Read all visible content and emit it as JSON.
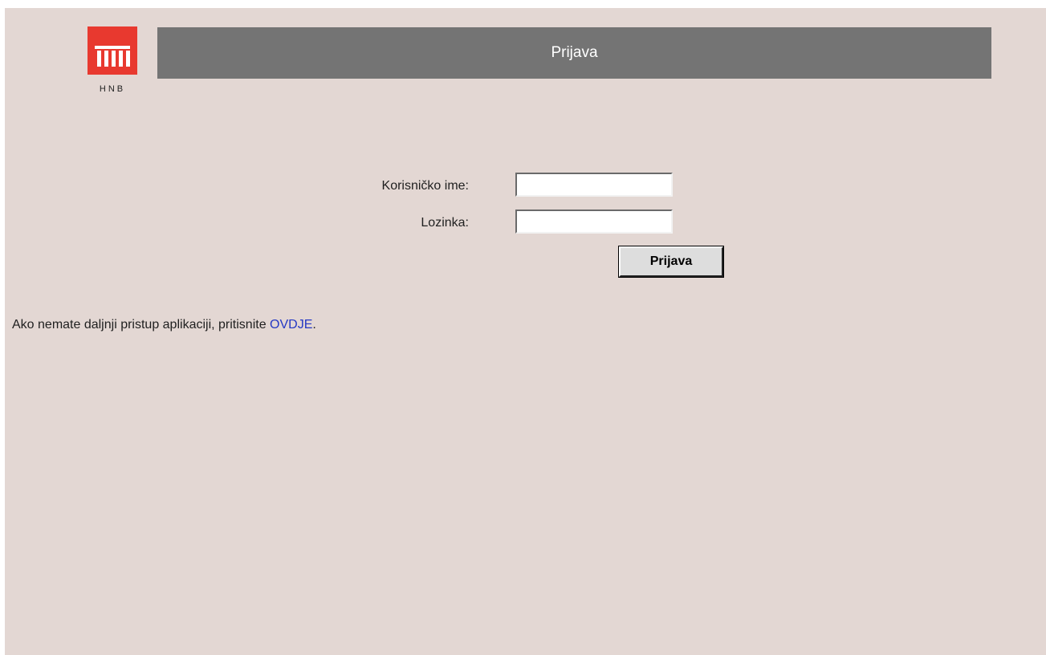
{
  "header": {
    "logo_text": "HNB",
    "title": "Prijava"
  },
  "login_form": {
    "username_label": "Korisničko ime:",
    "username_value": "",
    "password_label": "Lozinka:",
    "password_value": "",
    "submit_label": "Prijava"
  },
  "notice": {
    "text": "Ako nemate daljnji pristup aplikaciji, pritisnite ",
    "link_text": "OVDJE",
    "suffix": "."
  },
  "colors": {
    "logo_red": "#e8392f",
    "title_bar": "#747474",
    "page_background": "#e3d7d3",
    "link": "#2438c4"
  }
}
